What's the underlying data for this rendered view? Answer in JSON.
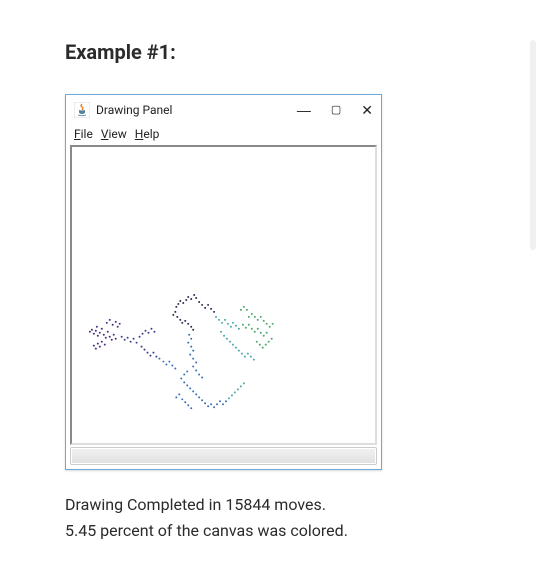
{
  "heading": "Example #1:",
  "window": {
    "title": "Drawing Panel",
    "controls": {
      "minimize": "—",
      "maximize": "▢",
      "close": "✕"
    },
    "menu": {
      "file_pre": "F",
      "file_rest": "ile",
      "view_pre": "V",
      "view_rest": "iew",
      "help_pre": "H",
      "help_rest": "elp"
    }
  },
  "caption_line1": "Drawing Completed in 15844 moves.",
  "caption_line2": "5.45 percent of the canvas was colored.",
  "drawing": {
    "moves": 15844,
    "percent_colored": 5.45,
    "colors": {
      "purple": "#4b2e83",
      "indigo": "#3b3f8c",
      "blue": "#3b6fb5",
      "teal": "#4aa8a8",
      "green": "#4aa86a"
    }
  }
}
